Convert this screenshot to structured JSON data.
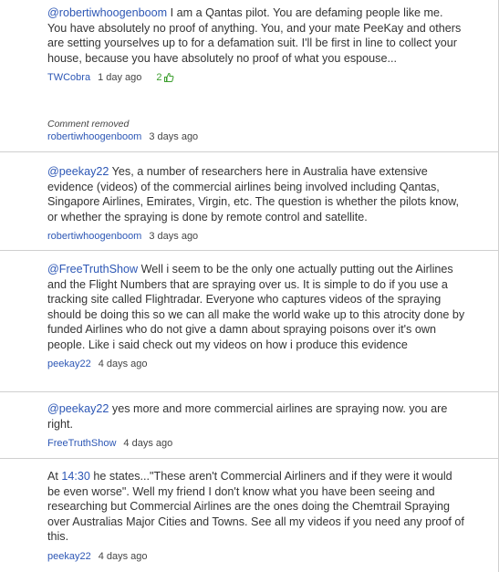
{
  "comments": [
    {
      "mention": "@robertiwhoogenboom",
      "text": " I am a Qantas pilot. You are defaming people like me. You have absolutely no proof of anything. You, and your mate PeeKay and others are setting yourselves up to for a defamation suit. I'll be first in line to collect your house, because you have absolutely no proof of what you espouse...",
      "author": "TWCobra",
      "time": "1 day ago",
      "likes": "2"
    },
    {
      "removed": "Comment removed",
      "author": "robertiwhoogenboom",
      "time": "3 days ago"
    },
    {
      "mention": "@peekay22",
      "text": " Yes, a number of researchers here in Australia have extensive evidence (videos) of the commercial airlines being involved including Qantas, Singapore Airlines, Emirates, Virgin, etc. The question is whether the pilots know, or whether the spraying is done by remote control and satellite.",
      "author": "robertiwhoogenboom",
      "time": "3 days ago"
    },
    {
      "mention": "@FreeTruthShow",
      "text": " Well i seem to be the only one actually putting out the Airlines and the Flight Numbers that are spraying over us. It is simple to do if you use a tracking site called Flightradar. Everyone who captures videos of the spraying should be doing this so we can all make the world wake up to this atrocity done by funded Airlines who do not give a damn about spraying poisons over it's own people. Like i said check out my videos on how i produce this evidence",
      "author": "peekay22",
      "time": "4 days ago"
    },
    {
      "mention": "@peekay22",
      "text": " yes more and more commercial airlines are spraying now. you are right.",
      "author": "FreeTruthShow",
      "time": "4 days ago"
    },
    {
      "prefix": "At ",
      "timestamp": "14:30",
      "text": " he states...\"These aren't Commercial Airliners and if they were it would be even worse\". Well my friend I don't know what you have been seeing and researching but Commercial Airlines are the ones doing the Chemtrail Spraying over Australias Major Cities and Towns. See all my videos if you need any proof of this.",
      "author": "peekay22",
      "time": "4 days ago"
    }
  ],
  "icons": {
    "like": "thumbs-up-icon"
  },
  "colors": {
    "link": "#2d57b5",
    "likes": "#3d9f2f",
    "text": "#333333",
    "separator": "#cfcfcf"
  }
}
